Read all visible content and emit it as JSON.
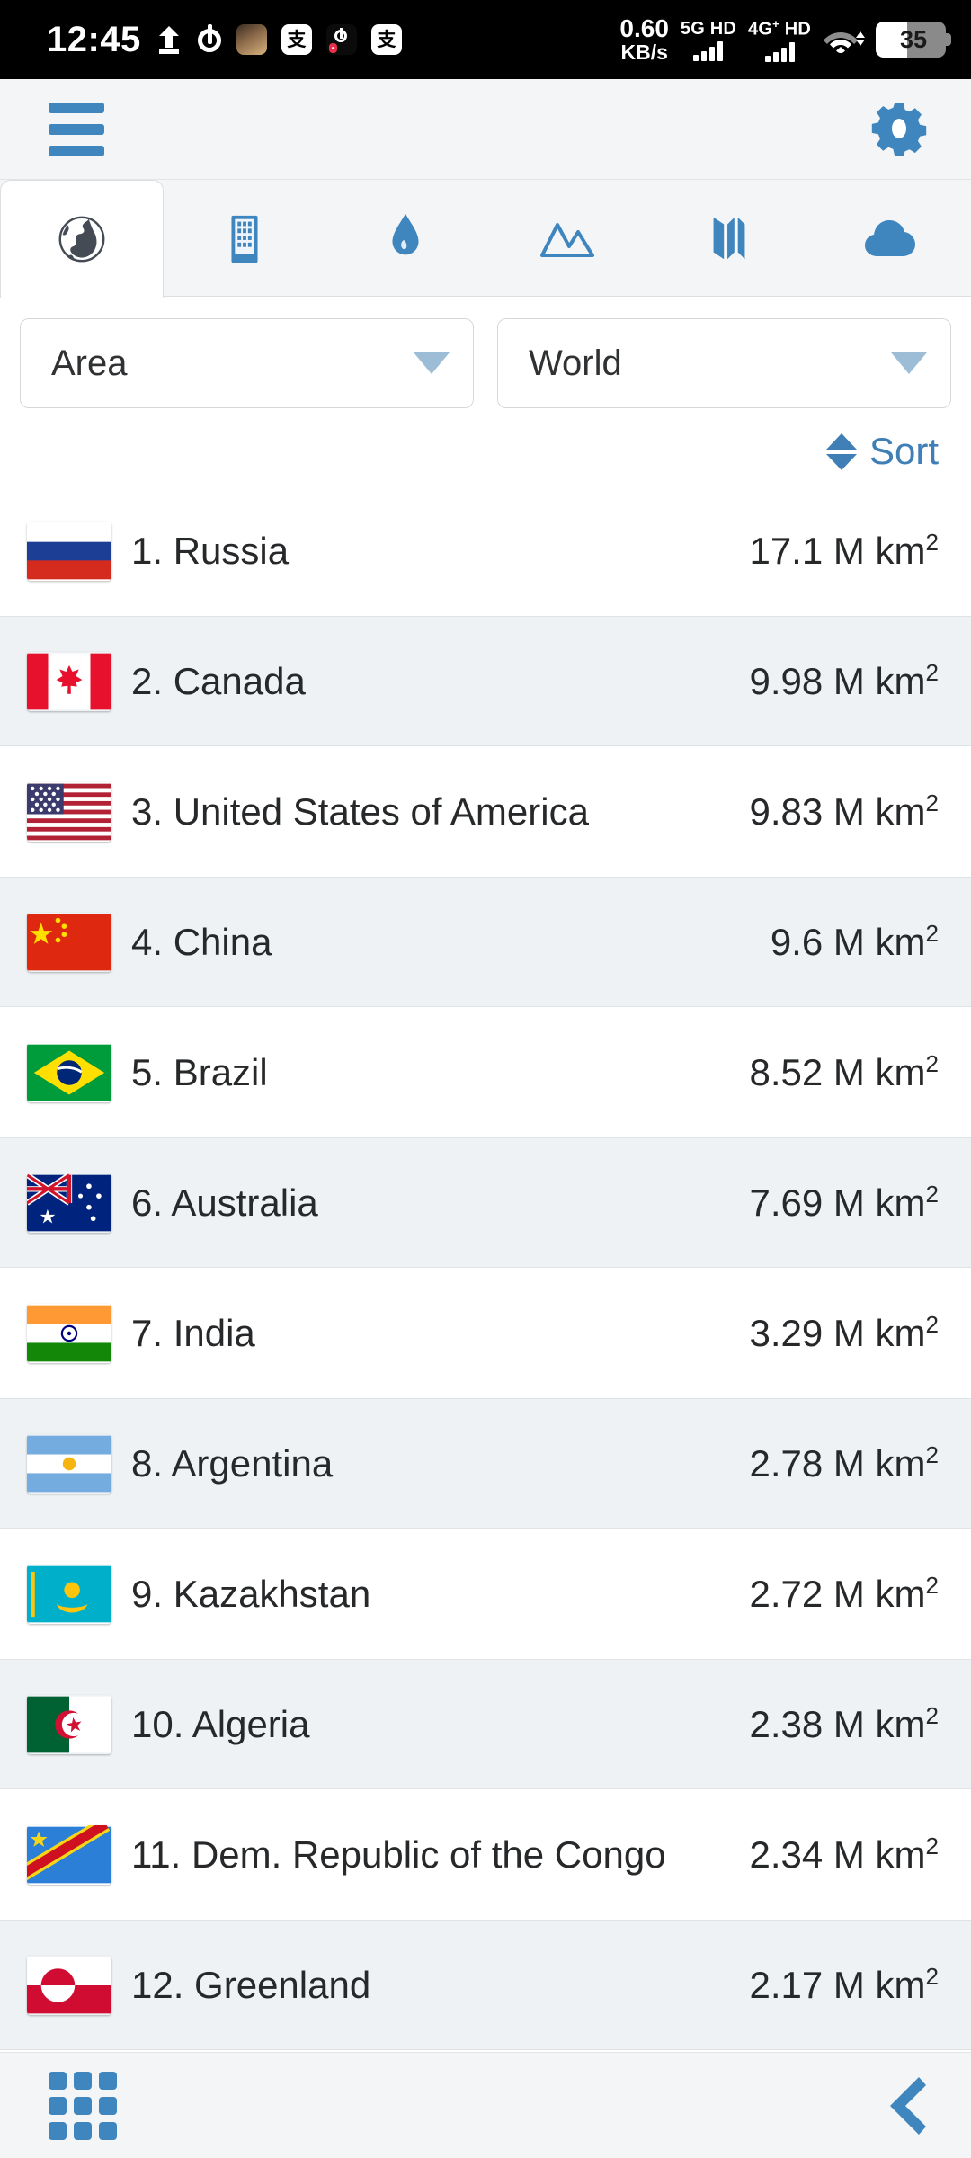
{
  "status_bar": {
    "clock": "12:45",
    "network_speed_value": "0.60",
    "network_speed_unit": "KB/s",
    "sim1_label": "5G HD",
    "sim2_label_main": "4G",
    "sim2_label_sup": "+",
    "sim2_label_tail": "HD",
    "battery_percent": "35",
    "icons": [
      "upload-icon",
      "tiktok-note-icon",
      "game-app-icon",
      "alipay-app-icon",
      "tiktok-app-icon",
      "alipay-app-icon-2",
      "wifi-icon",
      "battery-icon"
    ]
  },
  "header": {
    "menu_icon": "hamburger-menu-icon",
    "settings_icon": "gear-icon"
  },
  "tabs": [
    {
      "name": "globe",
      "icon": "globe-icon",
      "active": true
    },
    {
      "name": "city",
      "icon": "building-icon",
      "active": false
    },
    {
      "name": "water",
      "icon": "water-drop-icon",
      "active": false
    },
    {
      "name": "mountain",
      "icon": "mountains-icon",
      "active": false
    },
    {
      "name": "map",
      "icon": "map-icon",
      "active": false
    },
    {
      "name": "weather",
      "icon": "cloud-icon",
      "active": false
    }
  ],
  "filters": {
    "metric": {
      "value": "Area",
      "caret": "chevron-down-icon"
    },
    "region": {
      "value": "World",
      "caret": "chevron-down-icon"
    }
  },
  "sort": {
    "label": "Sort",
    "icon": "sort-updown-icon"
  },
  "list": {
    "unit": "M km",
    "unit_sup": "2",
    "rows": [
      {
        "rank": "1.",
        "name": "Russia",
        "value": "17.1 M km",
        "flag": "ru"
      },
      {
        "rank": "2.",
        "name": "Canada",
        "value": "9.98 M km",
        "flag": "ca"
      },
      {
        "rank": "3.",
        "name": "United States of America",
        "value": "9.83 M km",
        "flag": "us"
      },
      {
        "rank": "4.",
        "name": "China",
        "value": "9.6 M km",
        "flag": "cn"
      },
      {
        "rank": "5.",
        "name": "Brazil",
        "value": "8.52 M km",
        "flag": "br"
      },
      {
        "rank": "6.",
        "name": "Australia",
        "value": "7.69 M km",
        "flag": "au"
      },
      {
        "rank": "7.",
        "name": "India",
        "value": "3.29 M km",
        "flag": "in"
      },
      {
        "rank": "8.",
        "name": "Argentina",
        "value": "2.78 M km",
        "flag": "ar"
      },
      {
        "rank": "9.",
        "name": "Kazakhstan",
        "value": "2.72 M km",
        "flag": "kz"
      },
      {
        "rank": "10.",
        "name": "Algeria",
        "value": "2.38 M km",
        "flag": "dz"
      },
      {
        "rank": "11.",
        "name": "Dem. Republic of the Congo",
        "value": "2.34 M km",
        "flag": "cd"
      },
      {
        "rank": "12.",
        "name": "Greenland",
        "value": "2.17 M km",
        "flag": "gl"
      }
    ]
  },
  "bottom_nav": {
    "apps_icon": "apps-grid-icon",
    "back_icon": "back-chevron-icon"
  },
  "colors": {
    "accent_blue": "#3f86bf",
    "link_blue": "#3f7fb5",
    "row_alt": "#eef2f5",
    "chrome": "#f4f5f6"
  }
}
